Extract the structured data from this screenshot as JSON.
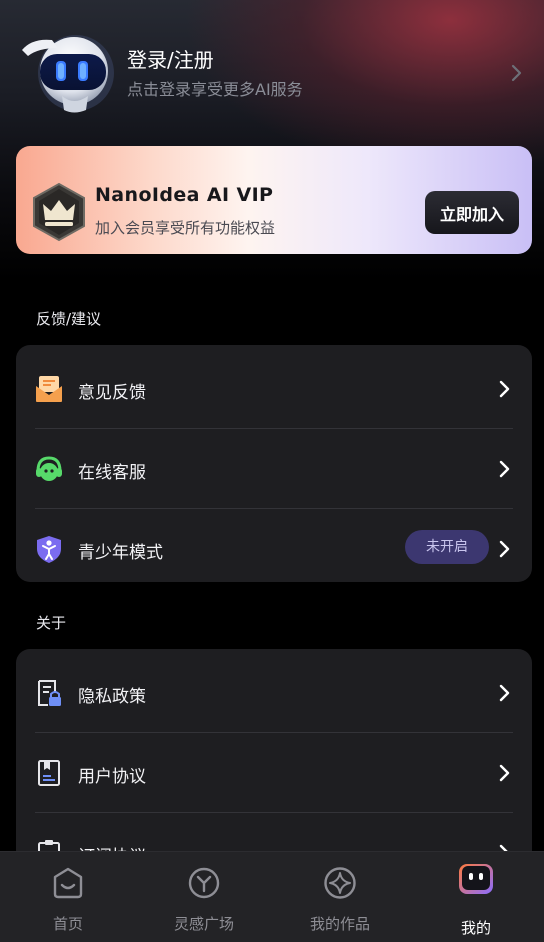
{
  "header": {
    "login_title": "登录/注册",
    "login_subtitle": "点击登录享受更多AI服务",
    "avatar_icon": "robot-avatar-icon"
  },
  "vip": {
    "title": "NanoIdea AI VIP",
    "subtitle": "加入会员享受所有功能权益",
    "button_label": "立即加入",
    "badge_icon": "crown-icon"
  },
  "sections": [
    {
      "label": "反馈/建议",
      "items": [
        {
          "label": "意见反馈",
          "icon": "feedback-mail-icon"
        },
        {
          "label": "在线客服",
          "icon": "headset-icon"
        },
        {
          "label": "青少年模式",
          "icon": "youth-shield-icon",
          "badge": "未开启"
        }
      ]
    },
    {
      "label": "关于",
      "items": [
        {
          "label": "隐私政策",
          "icon": "privacy-doc-icon"
        },
        {
          "label": "用户协议",
          "icon": "agreement-book-icon"
        },
        {
          "label": "订阅协议",
          "icon": "subscription-clipboard-icon"
        }
      ]
    }
  ],
  "tabbar": {
    "tabs": [
      {
        "label": "首页",
        "icon": "home-icon",
        "active": false
      },
      {
        "label": "灵感广场",
        "icon": "inspiration-icon",
        "active": false
      },
      {
        "label": "我的作品",
        "icon": "sparkle-icon",
        "active": false
      },
      {
        "label": "我的",
        "icon": "robot-face-icon",
        "active": true
      }
    ]
  },
  "colors": {
    "background": "#000000",
    "card": "#1e1e21",
    "badge_bg": "#3c3770",
    "tab_active": "#ffffff",
    "tab_inactive": "#8e8e95"
  }
}
